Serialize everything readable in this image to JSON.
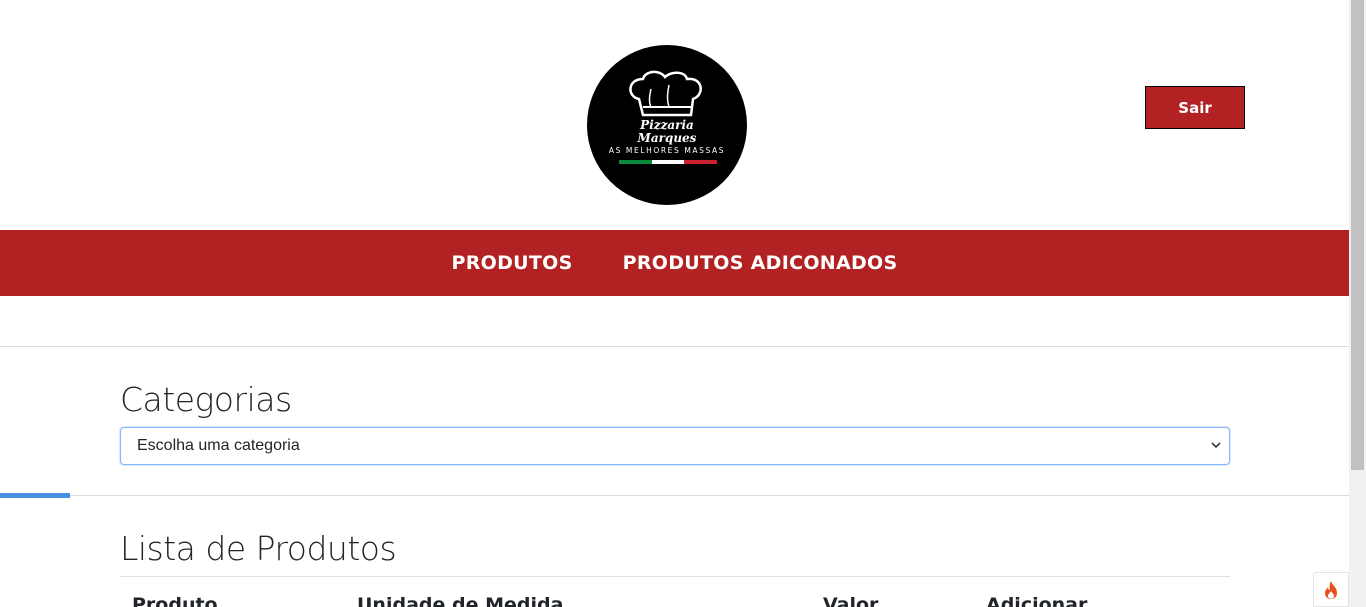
{
  "header": {
    "logo_lines": [
      "Pizzaria",
      "Marques"
    ],
    "logo_tagline": "AS MELHORES MASSAS",
    "logout_label": "Sair"
  },
  "nav": {
    "items": [
      {
        "label": "PRODUTOS"
      },
      {
        "label": "PRODUTOS ADICONADOS"
      }
    ]
  },
  "categories": {
    "title": "Categorias",
    "select_value": "Escolha uma categoria"
  },
  "products": {
    "title": "Lista de Produtos",
    "columns": [
      "Produto",
      "Unidade de Medida",
      "Valor",
      "Adicionar"
    ]
  },
  "colors": {
    "brand_red": "#b22222",
    "focus_blue": "#86b7fe",
    "progress_blue": "#4a90e2"
  },
  "icons": {
    "logo": "chef-hat-icon",
    "select": "chevron-down-icon",
    "floating": "fire-icon"
  }
}
